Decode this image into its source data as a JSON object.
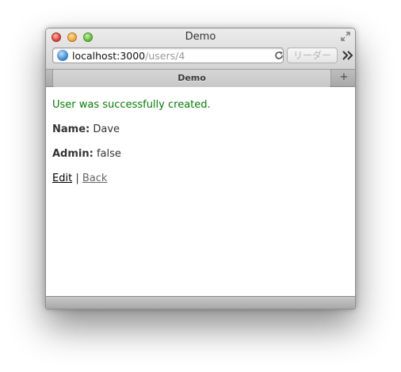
{
  "window": {
    "title": "Demo"
  },
  "toolbar": {
    "url_host": "localhost:3000",
    "url_path": "/users/4",
    "reader_label": "リーダー",
    "more_label": "»"
  },
  "tabs": [
    {
      "label": "Demo"
    }
  ],
  "tabbar": {
    "new_tab_label": "+"
  },
  "page": {
    "notice": "User was successfully created.",
    "name_label": "Name:",
    "name_value": "Dave",
    "admin_label": "Admin:",
    "admin_value": "false",
    "edit_link": "Edit",
    "separator": "|",
    "back_link": "Back"
  },
  "colors": {
    "notice": "#008000",
    "text": "#333333"
  },
  "icons": {
    "close": "close-icon",
    "minimize": "minimize-icon",
    "maximize": "maximize-icon",
    "fullscreen": "fullscreen-icon",
    "site": "globe-icon",
    "reload": "reload-icon",
    "more": "more-icon"
  }
}
